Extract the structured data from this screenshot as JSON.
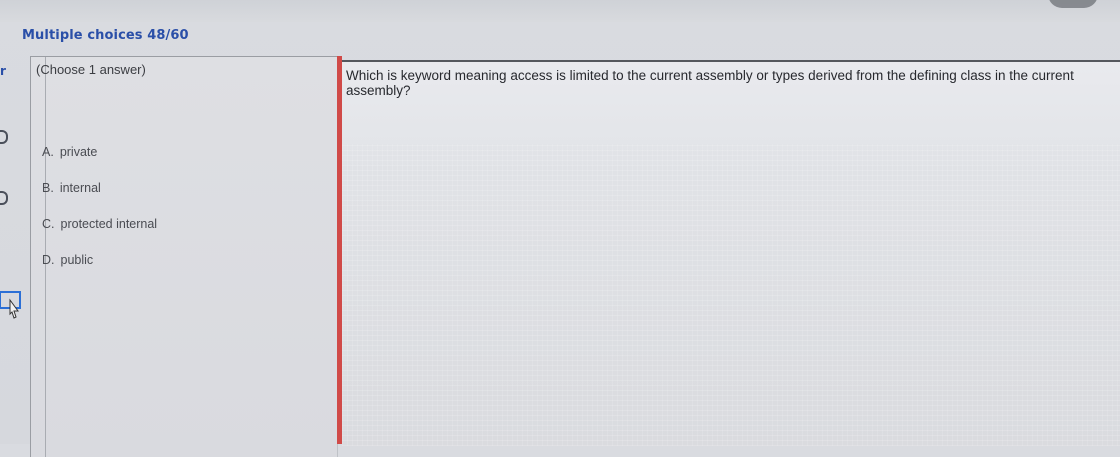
{
  "header": {
    "title": "Multiple choices 48/60"
  },
  "left_edge": {
    "label": "r"
  },
  "answer_panel": {
    "instruction": "(Choose 1 answer)",
    "options": [
      {
        "letter": "A.",
        "text": "private"
      },
      {
        "letter": "B.",
        "text": "internal"
      },
      {
        "letter": "C.",
        "text": "protected internal"
      },
      {
        "letter": "D.",
        "text": "public"
      }
    ]
  },
  "question": {
    "text": "Which is keyword meaning access is limited to the current assembly or types derived from the defining class in the current assembly?"
  },
  "colors": {
    "accent_blue": "#2a4fa8",
    "divider_red": "#d04a48",
    "background": "#d9dbe0"
  },
  "icons": {
    "cursor": "hand-pointer-icon"
  }
}
